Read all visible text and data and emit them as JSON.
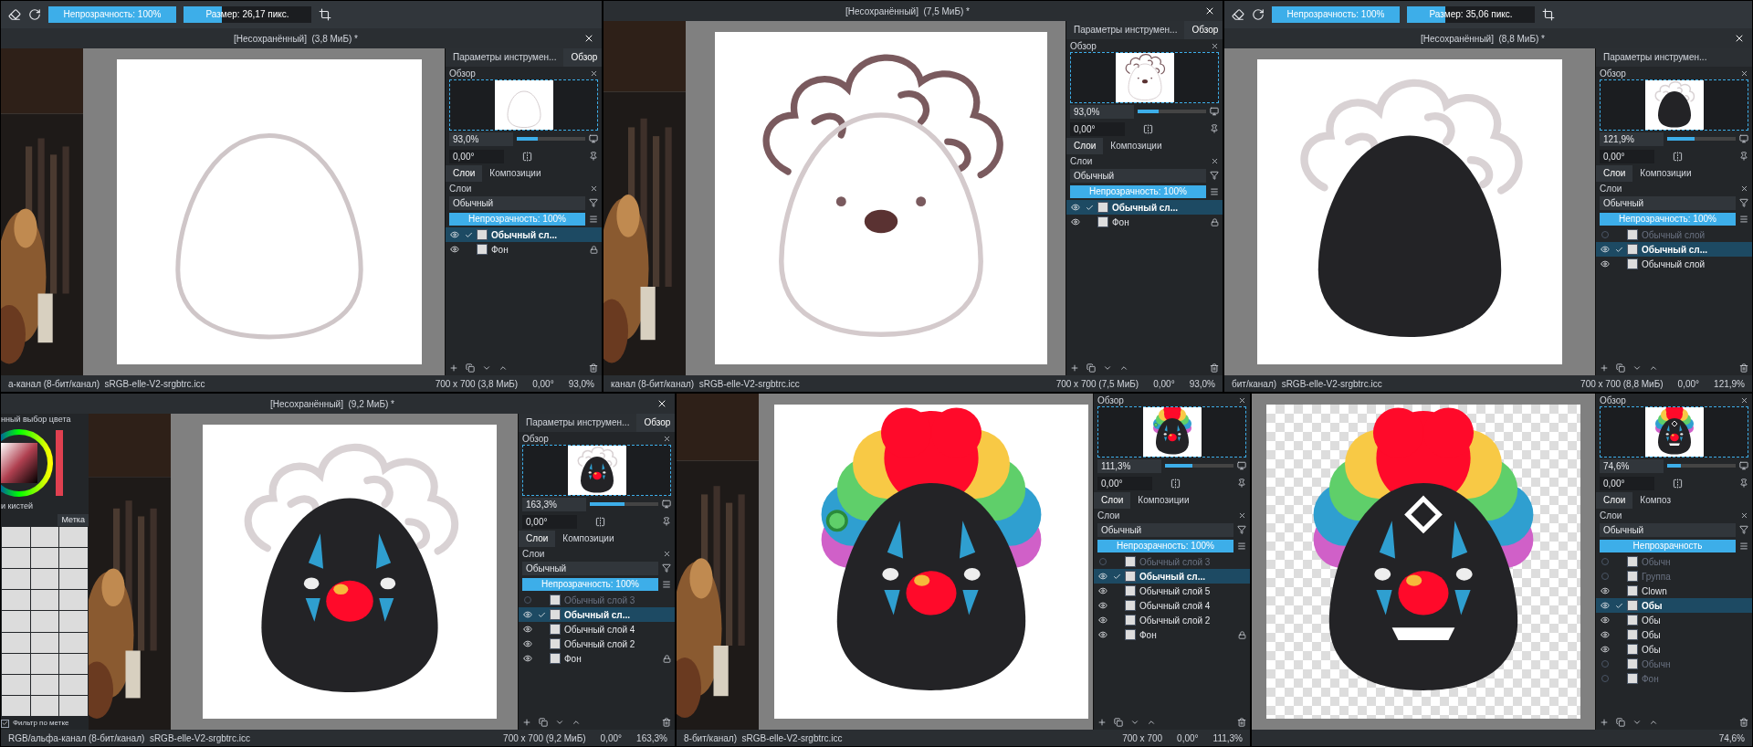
{
  "panes": [
    {
      "kind": "outline",
      "reference": true,
      "toolbar": {
        "opacity": {
          "label": "Непрозрачность: 100%",
          "level": 1
        },
        "size": {
          "label": "Размер: 26,17 пикс.",
          "level": 0.3
        }
      },
      "title": "[Несохранённый]  (3,8 МиБ) *",
      "docker": {
        "tabs": [
          {
            "label": "Параметры инструмен...",
            "selected": false
          },
          {
            "label": "Обзор",
            "selected": true
          }
        ],
        "overview": "Обзор",
        "zoom": "93,0%",
        "zoom_slider": {
          "level": 0.3
        },
        "rotation": "0,00°",
        "layer_tabs": [
          {
            "label": "Слои",
            "selected": true
          },
          {
            "label": "Композиции",
            "selected": false
          }
        ],
        "layers_title": "Слои",
        "blend": "Обычный",
        "opacity": {
          "label": "Непрозрачность:  100%",
          "level": 1
        },
        "layers": [
          {
            "name": "Обычный сл...",
            "visible": true,
            "selected": true,
            "locked": false
          },
          {
            "name": "Фон",
            "visible": true,
            "selected": false,
            "locked": true
          }
        ]
      },
      "status": {
        "profile": "а-канал (8-бит/канал)  sRGB-elle-V2-srgbtrc.icc",
        "size": "700 x 700 (3,8 МиБ)",
        "rotation": "0,00°",
        "zoom": "93,0%"
      }
    },
    {
      "kind": "sketch",
      "reference": true,
      "title": "[Несохранённый]  (7,5 МиБ) *",
      "docker": {
        "tabs": [
          {
            "label": "Параметры инструмен...",
            "selected": false
          },
          {
            "label": "Обзор",
            "selected": true
          }
        ],
        "overview": "Обзор",
        "zoom": "93,0%",
        "zoom_slider": {
          "level": 0.3
        },
        "rotation": "0,00°",
        "layer_tabs": [
          {
            "label": "Слои",
            "selected": true
          },
          {
            "label": "Композиции",
            "selected": false
          }
        ],
        "layers_title": "Слои",
        "blend": "Обычный",
        "opacity": {
          "label": "Непрозрачность:  100%",
          "level": 1
        },
        "layers": [
          {
            "name": "Обычный сл...",
            "visible": true,
            "selected": true,
            "locked": false
          },
          {
            "name": "Фон",
            "visible": true,
            "selected": false,
            "locked": true
          }
        ]
      },
      "status": {
        "profile": "канал (8-бит/канал)  sRGB-elle-V2-srgbtrc.icc",
        "size": "700 x 700 (7,5 МиБ)",
        "rotation": "0,00°",
        "zoom": "93,0%"
      }
    },
    {
      "kind": "blob",
      "reference": false,
      "toolbar": {
        "opacity": {
          "label": "Непрозрачность: 100%",
          "level": 1
        },
        "size": {
          "label": "Размер: 35,06 пикс.",
          "level": 0.3
        }
      },
      "title": "[Несохранённый]  (8,8 МиБ) *",
      "docker": {
        "tabs": [
          {
            "label": "Параметры инструмен...",
            "selected": false
          }
        ],
        "overview": "Обзор",
        "zoom": "121,9%",
        "zoom_slider": {
          "level": 0.4
        },
        "rotation": "0,00°",
        "layer_tabs": [
          {
            "label": "Слои",
            "selected": true
          },
          {
            "label": "Композиции",
            "selected": false
          }
        ],
        "layers_title": "Слои",
        "blend": "Обычный",
        "opacity": {
          "label": "Непрозрачность:  100%",
          "level": 1
        },
        "layers": [
          {
            "name": "Обычный слой",
            "visible": false,
            "selected": false,
            "locked": false
          },
          {
            "name": "Обычный сл...",
            "visible": true,
            "selected": true,
            "locked": false
          },
          {
            "name": "Обычный слой",
            "visible": true,
            "selected": false,
            "locked": false
          }
        ]
      },
      "status": {
        "profile": "бит/канал)  sRGB-elle-V2-srgbtrc.icc",
        "size": "700 x 700 (8,8 МиБ)",
        "rotation": "0,00°",
        "zoom": "121,9%"
      }
    },
    {
      "kind": "nose",
      "reference": true,
      "title": "[Несохранённый]  (9,2 МиБ) *",
      "tools": {
        "color_title": "нный выбор цвета",
        "brushes_title": "и кистей",
        "tag": "Метка",
        "filter": "Фильтр по метке",
        "filter_checked": true
      },
      "docker": {
        "tabs": [
          {
            "label": "Параметры инструмен...",
            "selected": false
          },
          {
            "label": "Обзор",
            "selected": true
          }
        ],
        "overview": "Обзор",
        "zoom": "163,3%",
        "zoom_slider": {
          "level": 0.5
        },
        "rotation": "0,00°",
        "layer_tabs": [
          {
            "label": "Слои",
            "selected": true
          },
          {
            "label": "Композиции",
            "selected": false
          }
        ],
        "layers_title": "Слои",
        "blend": "Обычный",
        "opacity": {
          "label": "Непрозрачность:  100%",
          "level": 1
        },
        "layers": [
          {
            "name": "Обычный слой 3",
            "visible": false,
            "selected": false,
            "locked": false
          },
          {
            "name": "Обычный сл...",
            "visible": true,
            "selected": true,
            "locked": false
          },
          {
            "name": "Обычный слой 4",
            "visible": true,
            "selected": false,
            "locked": false
          },
          {
            "name": "Обычный слой 2",
            "visible": true,
            "selected": false,
            "locked": false
          },
          {
            "name": "Фон",
            "visible": true,
            "selected": false,
            "locked": true
          }
        ]
      },
      "status": {
        "profile": "RGB/альфа-канал (8-бит/канал)  sRGB-elle-V2-srgbtrc.icc",
        "size": "700 x 700 (9,2 МиБ)",
        "rotation": "0,00°",
        "zoom": "163,3%"
      }
    },
    {
      "kind": "hair",
      "reference": true,
      "docker": {
        "overview": "Обзор",
        "zoom": "111,3%",
        "zoom_slider": {
          "level": 0.4
        },
        "rotation": "0,00°",
        "layer_tabs": [
          {
            "label": "Слои",
            "selected": true
          },
          {
            "label": "Композиции",
            "selected": false
          }
        ],
        "layers_title": "Слои",
        "blend": "Обычный",
        "opacity": {
          "label": "Непрозрачность:  100%",
          "level": 1
        },
        "layers": [
          {
            "name": "Обычный слой 3",
            "visible": false,
            "selected": false,
            "locked": false
          },
          {
            "name": "Обычный сл...",
            "visible": true,
            "selected": true,
            "locked": false
          },
          {
            "name": "Обычный слой 5",
            "visible": true,
            "selected": false,
            "locked": false
          },
          {
            "name": "Обычный слой 4",
            "visible": true,
            "selected": false,
            "locked": false
          },
          {
            "name": "Обычный слой 2",
            "visible": true,
            "selected": false,
            "locked": false
          },
          {
            "name": "Фон",
            "visible": true,
            "selected": false,
            "locked": true
          }
        ]
      },
      "status": {
        "profile": "8-бит/канал)  sRGB-elle-V2-srgbtrc.icc",
        "size": "700 x 700",
        "rotation": "0,00°",
        "zoom": "111,3%"
      }
    },
    {
      "kind": "final",
      "reference": false,
      "docker": {
        "overview": "Обзор",
        "zoom": "74,6%",
        "zoom_slider": {
          "level": 0.2
        },
        "rotation": "0,00°",
        "layer_tabs": [
          {
            "label": "Слои",
            "selected": true
          },
          {
            "label": "Композ",
            "selected": false
          }
        ],
        "layers_title": "Слои",
        "blend": "Обычный",
        "opacity": {
          "label": "Непрозрачность",
          "level": 1
        },
        "layers": [
          {
            "name": "Обычн",
            "visible": false,
            "selected": false,
            "locked": false
          },
          {
            "name": "Группа",
            "visible": false,
            "selected": false,
            "locked": false
          },
          {
            "name": "Clown",
            "visible": true,
            "selected": false,
            "locked": false
          },
          {
            "name": "Обы",
            "visible": true,
            "selected": true,
            "locked": false
          },
          {
            "name": "Обы",
            "visible": true,
            "selected": false,
            "locked": false
          },
          {
            "name": "Обы",
            "visible": true,
            "selected": false,
            "locked": false
          },
          {
            "name": "Обы",
            "visible": true,
            "selected": false,
            "locked": false
          },
          {
            "name": "Обычн",
            "visible": false,
            "selected": false,
            "locked": false
          },
          {
            "name": "Фон",
            "visible": false,
            "selected": false,
            "locked": false
          }
        ]
      },
      "status": {
        "zoom": "74,6%"
      }
    }
  ]
}
